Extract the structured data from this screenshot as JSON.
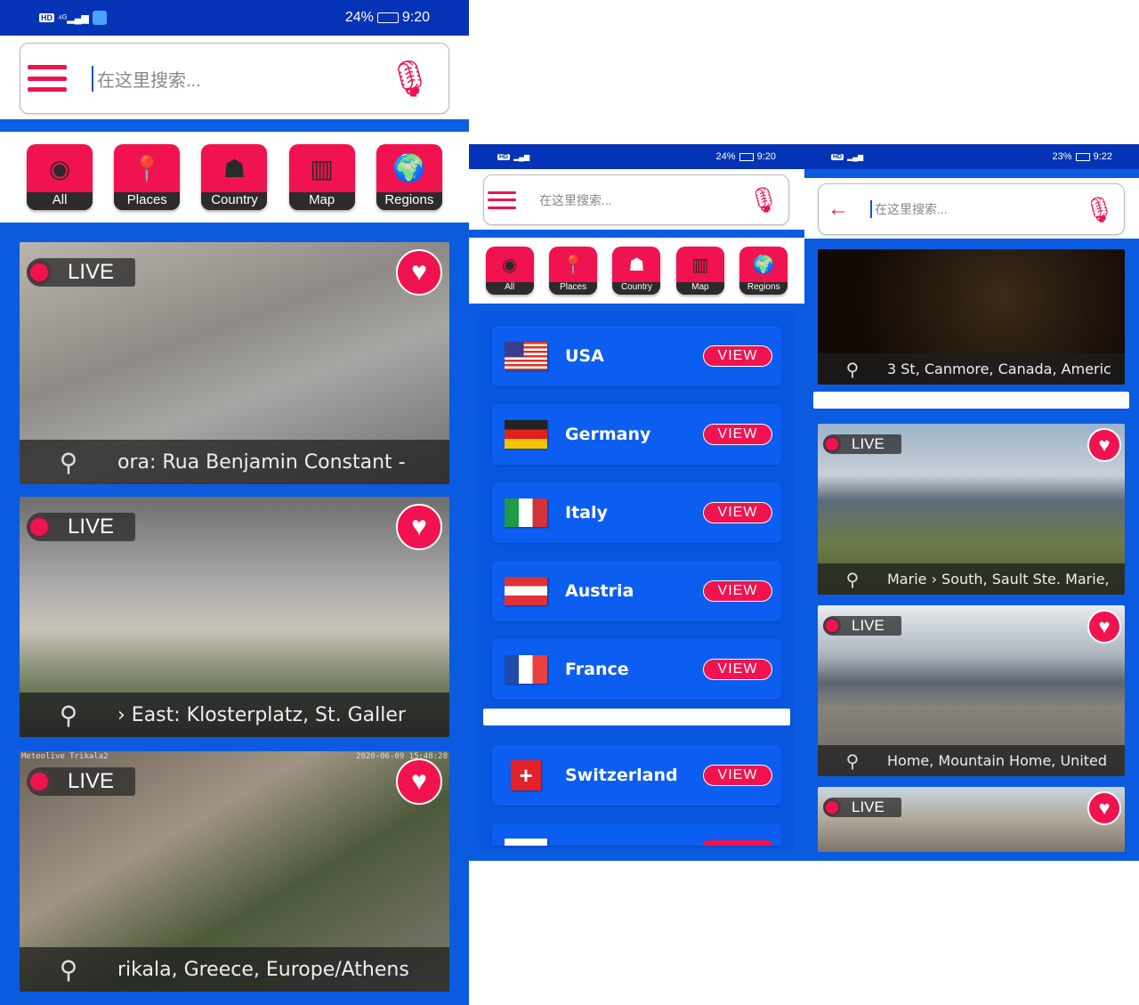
{
  "screens": [
    {
      "status": {
        "battery": "24%",
        "time": "9:20"
      },
      "search_placeholder": "在这里搜索...",
      "categories": [
        "All",
        "Places",
        "Country",
        "Map",
        "Regions"
      ],
      "cards": [
        {
          "live": "LIVE",
          "caption": "ora: Rua Benjamin Constant -"
        },
        {
          "live": "LIVE",
          "caption": "› East: Klosterplatz, St. Galler"
        },
        {
          "live": "LIVE",
          "caption": "rikala, Greece, Europe/Athens",
          "overlay_left": "Meteolive Trikala2",
          "overlay_right": "2020-06-09 15:48:28"
        }
      ]
    },
    {
      "status": {
        "battery": "24%",
        "time": "9:20"
      },
      "search_placeholder": "在这里搜索...",
      "categories": [
        "All",
        "Places",
        "Country",
        "Map",
        "Regions"
      ],
      "countries": [
        {
          "name": "USA",
          "action": "VIEW"
        },
        {
          "name": "Germany",
          "action": "VIEW"
        },
        {
          "name": "Italy",
          "action": "VIEW"
        },
        {
          "name": "Austria",
          "action": "VIEW"
        },
        {
          "name": "France",
          "action": "VIEW"
        },
        {
          "name": "Switzerland",
          "action": "VIEW"
        }
      ]
    },
    {
      "status": {
        "battery": "23%",
        "time": "9:22"
      },
      "search_placeholder": "在这里搜索...",
      "cards": [
        {
          "caption": "3 St, Canmore, Canada, Americ"
        },
        {
          "live": "LIVE",
          "caption": "Marie › South, Sault Ste. Marie,"
        },
        {
          "live": "LIVE",
          "caption": "Home, Mountain Home, United"
        },
        {
          "live": "LIVE"
        }
      ]
    }
  ],
  "colors": {
    "accent": "#f0134f",
    "status_bar": "#0533b5",
    "list_bg": "#0a5be0"
  }
}
